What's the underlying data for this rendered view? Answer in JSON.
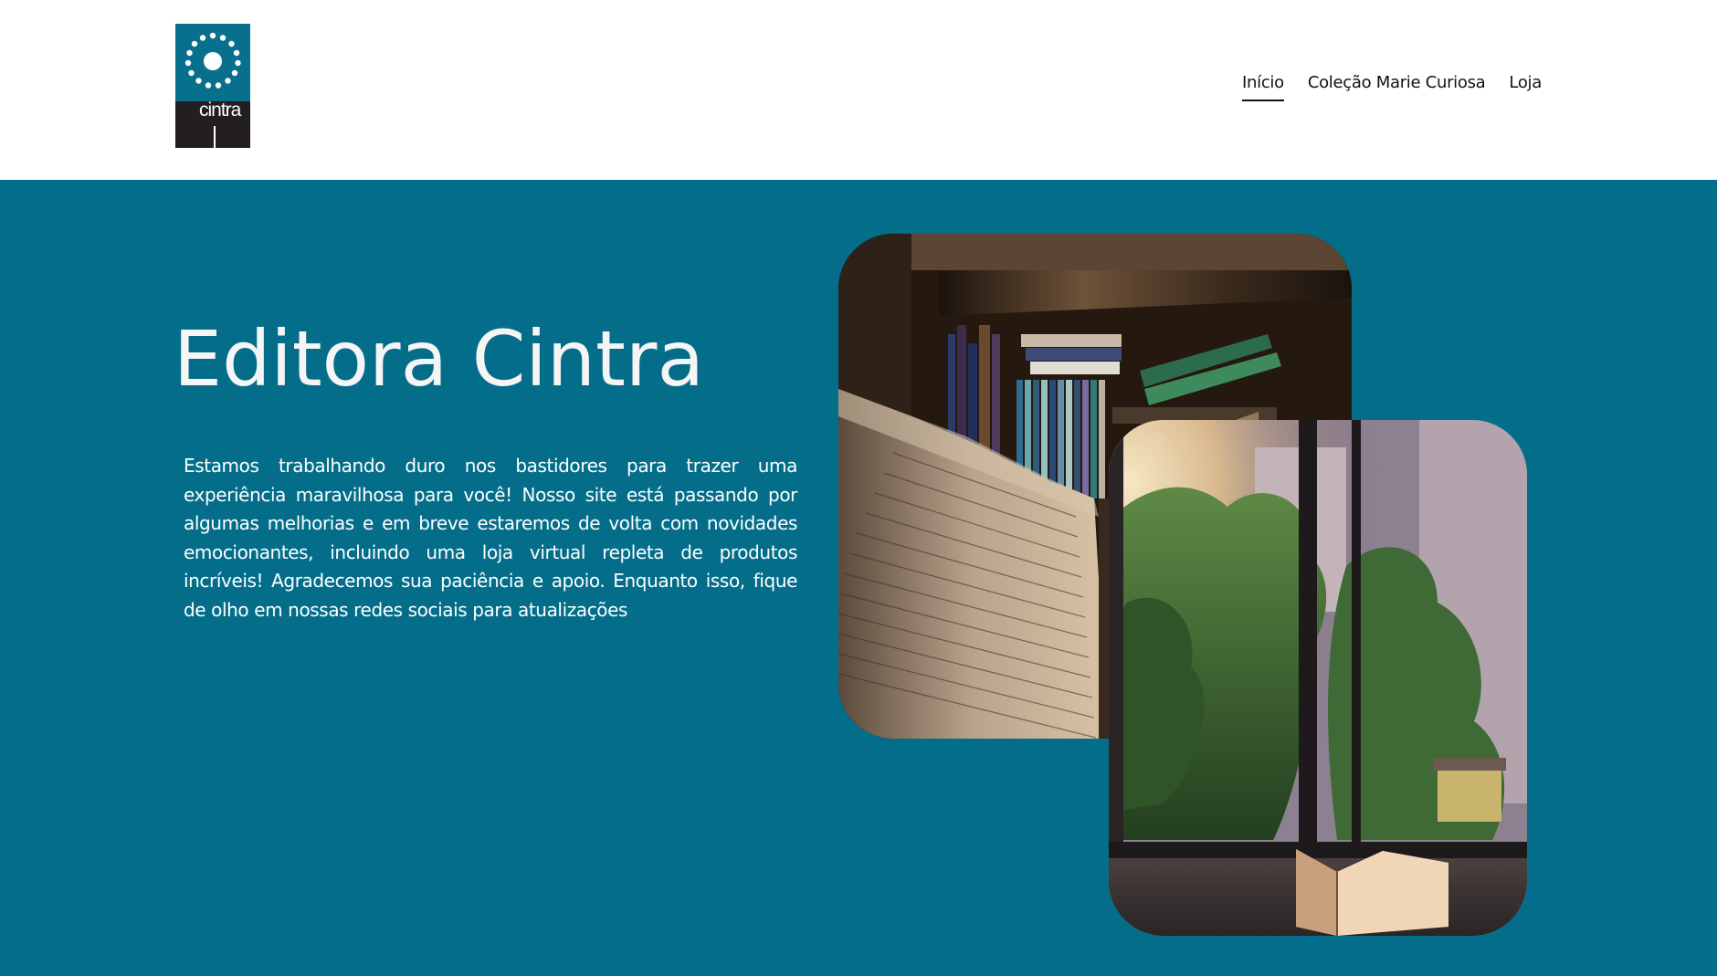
{
  "brand": {
    "logo_text": "cintra",
    "logo_colors": {
      "top": "#08708c",
      "bottom": "#231f20"
    }
  },
  "nav": {
    "items": [
      {
        "label": "Início",
        "active": true
      },
      {
        "label": "Coleção Marie Curiosa",
        "active": false
      },
      {
        "label": "Loja",
        "active": false
      }
    ]
  },
  "hero": {
    "title": "Editora Cintra",
    "text": "Estamos trabalhando duro nos bastidores para trazer uma experiência maravilhosa para você! Nosso site está passando por algumas melhorias e em breve estaremos de volta com novidades emocionantes, incluindo uma loja virtual repleta de produtos incríveis! Agradecemos sua paciência e apoio. Enquanto isso, fique de olho em nossas redes sociais para atualizações",
    "background": "#046e8a"
  },
  "images": {
    "books_photo": "open-book-bookshelf-photo",
    "window_photo": "window-open-book-photo"
  }
}
